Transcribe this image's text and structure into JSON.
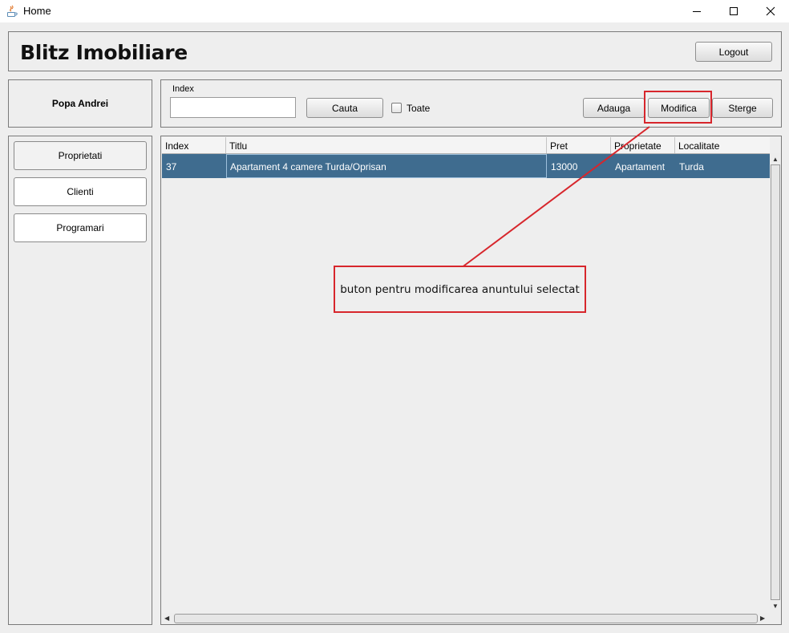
{
  "window": {
    "title": "Home",
    "app_icon": "java-icon",
    "controls": [
      "minimize",
      "maximize",
      "close"
    ]
  },
  "header": {
    "brand": "Blitz Imobiliare",
    "logout_label": "Logout"
  },
  "user": {
    "name": "Popa Andrei"
  },
  "toolbar": {
    "index_label": "Index",
    "index_value": "",
    "search_label": "Cauta",
    "all_label": "Toate",
    "all_checked": false,
    "add_label": "Adauga",
    "edit_label": "Modifica",
    "delete_label": "Sterge"
  },
  "sidebar": {
    "items": [
      {
        "label": "Proprietati"
      },
      {
        "label": "Clienti"
      },
      {
        "label": "Programari"
      }
    ]
  },
  "table": {
    "columns": [
      "Index",
      "Titlu",
      "Pret",
      "Proprietate",
      "Localitate"
    ],
    "rows": [
      {
        "cells": [
          "37",
          "Apartament 4 camere Turda/Oprisan",
          "13000",
          "Apartament",
          "Turda"
        ],
        "selected": true
      }
    ]
  },
  "annotation": {
    "text": "buton pentru modificarea anuntului selectat",
    "color": "#d7262c"
  },
  "colors": {
    "selection": "#3f6c8f",
    "annotation": "#d7262c"
  }
}
